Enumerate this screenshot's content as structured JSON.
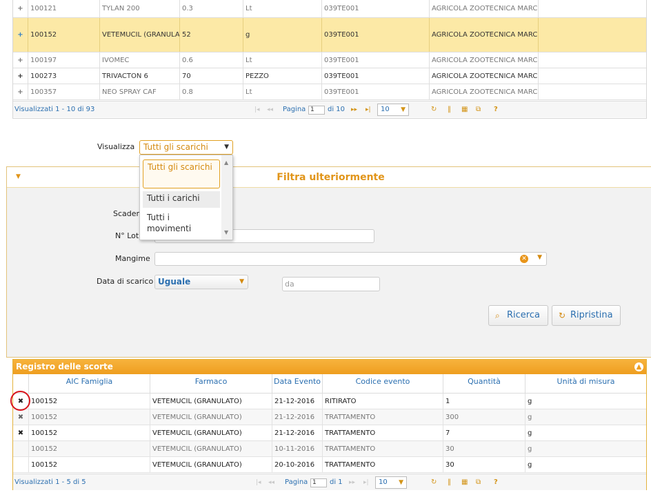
{
  "top_grid": {
    "rows": [
      {
        "expander": "+",
        "aic": "100121",
        "farmaco": "TYLAN 200",
        "qty": "0.3",
        "unit": "Lt",
        "code": "039TE001",
        "company": "AGRICOLA ZOOTECNICA MARCHI",
        "dim": true
      },
      {
        "expander": "+",
        "aic": "100152",
        "farmaco": "VETEMUCIL (GRANULAT",
        "qty": "52",
        "unit": "g",
        "code": "039TE001",
        "company": "AGRICOLA ZOOTECNICA MARCHI",
        "selected": true
      },
      {
        "expander": "+",
        "aic": "100197",
        "farmaco": "IVOMEC",
        "qty": "0.6",
        "unit": "Lt",
        "code": "039TE001",
        "company": "AGRICOLA ZOOTECNICA MARCHI",
        "dim": true
      },
      {
        "expander": "+",
        "aic": "100273",
        "farmaco": "TRIVACTON 6",
        "qty": "70",
        "unit": "PEZZO",
        "code": "039TE001",
        "company": "AGRICOLA ZOOTECNICA MARCHI"
      },
      {
        "expander": "+",
        "aic": "100357",
        "farmaco": "NEO SPRAY CAF",
        "qty": "0.8",
        "unit": "Lt",
        "code": "039TE001",
        "company": "AGRICOLA ZOOTECNICA MARCHI",
        "dim": true
      }
    ],
    "pager": {
      "summary": "Visualizzati 1 - 10 di 93",
      "page_label": "Pagina",
      "page_value": "1",
      "of_label": "di 10",
      "page_size": "10"
    }
  },
  "visualizza": {
    "label": "Visualizza",
    "selected": "Tutti gli scarichi",
    "options": [
      "Tutti gli scarichi",
      "Tutti i carichi",
      "Tutti i movimenti"
    ]
  },
  "filter": {
    "title": "Filtra ulteriormente",
    "scadenza_label": "Scaden",
    "lotto_label": "N° Lot",
    "mangime_label": "Mangime",
    "data_label": "Data di scarico",
    "data_operator": "Uguale",
    "da_placeholder": "da",
    "search_button": "Ricerca",
    "reset_button": "Ripristina"
  },
  "registro": {
    "title": "Registro delle scorte",
    "columns": [
      "AIC Famiglia",
      "Farmaco",
      "Data Evento",
      "Codice evento",
      "Quantità",
      "Unità di misura"
    ],
    "rows": [
      {
        "aic": "100152",
        "farmaco": "VETEMUCIL (GRANULATO)",
        "data": "21-12-2016",
        "codice": "RITIRATO",
        "qty": "1",
        "unit": "g",
        "deletable": true
      },
      {
        "aic": "100152",
        "farmaco": "VETEMUCIL (GRANULATO)",
        "data": "21-12-2016",
        "codice": "TRATTAMENTO",
        "qty": "300",
        "unit": "g",
        "deletable": true,
        "dim": true
      },
      {
        "aic": "100152",
        "farmaco": "VETEMUCIL (GRANULATO)",
        "data": "21-12-2016",
        "codice": "TRATTAMENTO",
        "qty": "7",
        "unit": "g",
        "deletable": true
      },
      {
        "aic": "100152",
        "farmaco": "VETEMUCIL (GRANULATO)",
        "data": "10-11-2016",
        "codice": "TRATTAMENTO",
        "qty": "30",
        "unit": "g",
        "deletable": false,
        "dim": true
      },
      {
        "aic": "100152",
        "farmaco": "VETEMUCIL (GRANULATO)",
        "data": "20-10-2016",
        "codice": "TRATTAMENTO",
        "qty": "30",
        "unit": "g",
        "deletable": false
      }
    ],
    "pager": {
      "summary": "Visualizzati 1 - 5 di 5",
      "page_label": "Pagina",
      "page_value": "1",
      "of_label": "di 1",
      "page_size": "10"
    }
  },
  "icons": {
    "delete": "close-x-icon",
    "refresh": "refresh-icon",
    "columns": "columns-icon",
    "table": "table-icon",
    "export": "export-icon",
    "help": "help-icon"
  },
  "colors": {
    "accent": "#ee9e1f",
    "link": "#2b6fb0",
    "selected_row": "#fce9a6",
    "highlight_circle": "#d8141b"
  }
}
